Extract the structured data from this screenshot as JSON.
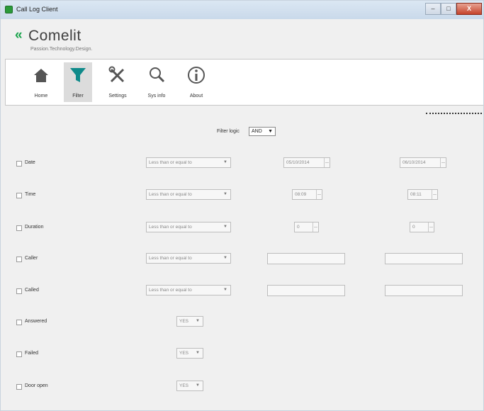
{
  "window": {
    "title": "Call Log Client",
    "controls": {
      "minimize": "–",
      "maximize": "□",
      "close": "X"
    }
  },
  "logo": {
    "name": "Comelit",
    "tagline": "Passion.Technology.Design."
  },
  "ribbon": {
    "buttons": [
      {
        "id": "home",
        "label": "Home",
        "icon": "home-icon",
        "active": false
      },
      {
        "id": "filter",
        "label": "Filter",
        "icon": "filter-icon",
        "active": true
      },
      {
        "id": "settings",
        "label": "Settings",
        "icon": "settings-tools-icon",
        "active": false
      },
      {
        "id": "sys-info",
        "label": "Sys info",
        "icon": "magnifier-icon",
        "active": false
      },
      {
        "id": "about",
        "label": "About",
        "icon": "info-icon",
        "active": false
      }
    ]
  },
  "filter": {
    "logic_label": "Filter logic",
    "logic_value": "AND",
    "rows": {
      "date": {
        "label": "Date",
        "operator": "Less than or equal to",
        "from": "05/10/2014",
        "to": "06/10/2014"
      },
      "time": {
        "label": "Time",
        "operator": "Less than or equal to",
        "from": "08:09",
        "to": "08:11"
      },
      "duration": {
        "label": "Duration",
        "operator": "Less than or equal to",
        "from": "0",
        "to": "0"
      },
      "caller": {
        "label": "Caller",
        "operator": "Less than or equal to",
        "from": "",
        "to": ""
      },
      "called": {
        "label": "Called",
        "operator": "Less than or equal to",
        "from": "",
        "to": ""
      },
      "answered": {
        "label": "Answered",
        "value": "YES"
      },
      "failed": {
        "label": "Failed",
        "value": "YES"
      },
      "door_open": {
        "label": "Door open",
        "value": "YES"
      }
    }
  },
  "colors": {
    "brand_green": "#17a34a",
    "filter_icon_teal": "#0f8a8a",
    "titlebar": "#c9d9ea",
    "close_button": "#c5432a"
  }
}
